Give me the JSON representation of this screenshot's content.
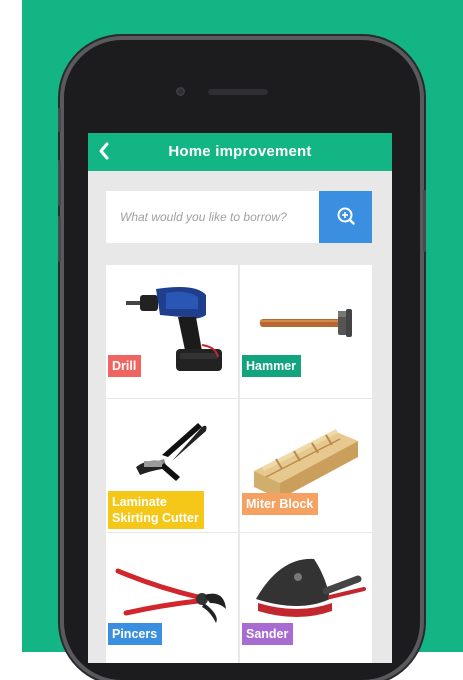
{
  "app": {
    "title": "Home improvement",
    "back_label": "‹"
  },
  "search": {
    "placeholder": "What would you like to borrow?"
  },
  "colors": {
    "accent": "#14b585",
    "search_button": "#3b8fe0"
  },
  "items": [
    {
      "label": "Drill",
      "color": "#ef6561",
      "icon": "drill-icon"
    },
    {
      "label": "Hammer",
      "color": "#12a47f",
      "icon": "hammer-icon"
    },
    {
      "label": "Laminate Skirting Cutter",
      "line1": "Laminate",
      "line2": "Skirting Cutter",
      "color": "#f5c718",
      "icon": "cutter-icon"
    },
    {
      "label": "Miter Block",
      "color": "#f5a161",
      "icon": "miter-block-icon"
    },
    {
      "label": "Pincers",
      "color": "#3b8fe0",
      "icon": "pincers-icon"
    },
    {
      "label": "Sander",
      "color": "#a86bd1",
      "icon": "sander-icon"
    }
  ]
}
